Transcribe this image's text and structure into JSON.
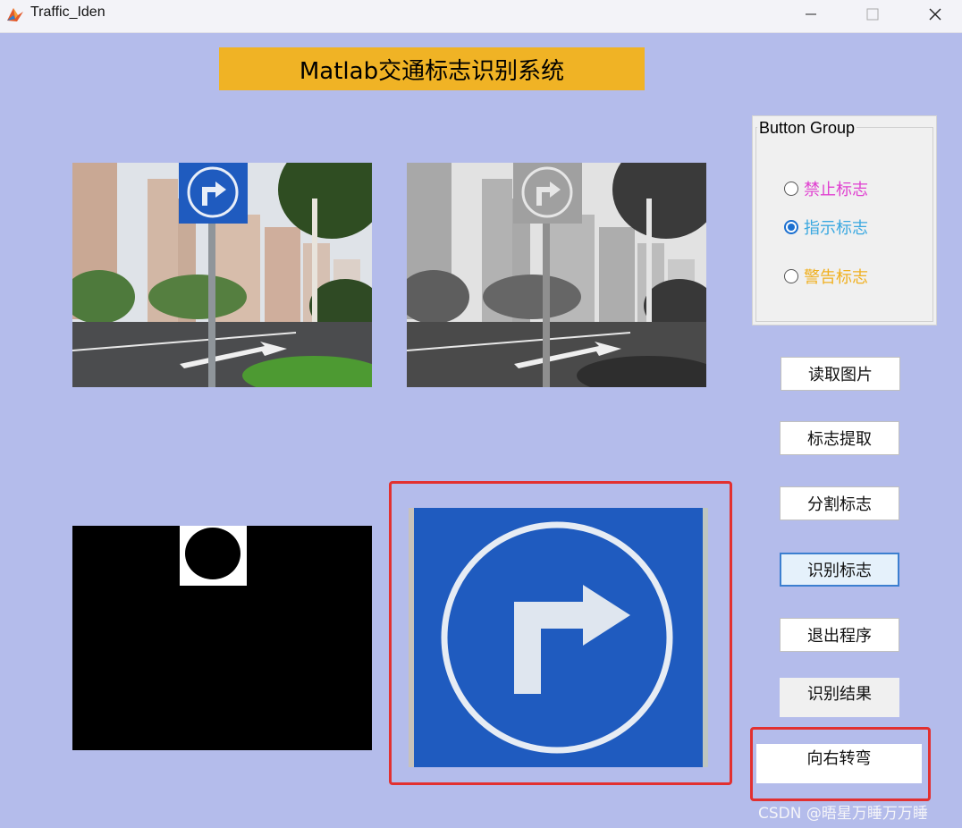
{
  "window": {
    "title": "Traffic_Iden",
    "icon": "matlab-icon",
    "controls": [
      "minimize-icon",
      "maximize-icon",
      "close-icon"
    ]
  },
  "app_title": "Matlab交通标志识别系统",
  "button_group": {
    "title": "Button Group",
    "options": [
      {
        "label": "禁止标志",
        "color": "#e040d0",
        "selected": false
      },
      {
        "label": "指示标志",
        "color": "#3aa8e0",
        "selected": true
      },
      {
        "label": "警告标志",
        "color": "#f0b020",
        "selected": false
      }
    ]
  },
  "buttons": {
    "read_image": "读取图片",
    "extract_sign": "标志提取",
    "segment_sign": "分割标志",
    "recognize_sign": "识别标志",
    "exit_program": "退出程序"
  },
  "result": {
    "label": "识别结果",
    "value": "向右转弯"
  },
  "watermark": "CSDN @晤星万睡万万睡",
  "colors": {
    "background": "#b4bceb",
    "title_bar": "#f0b325",
    "sign_blue": "#1f5bbf",
    "highlight": "#e23030"
  }
}
